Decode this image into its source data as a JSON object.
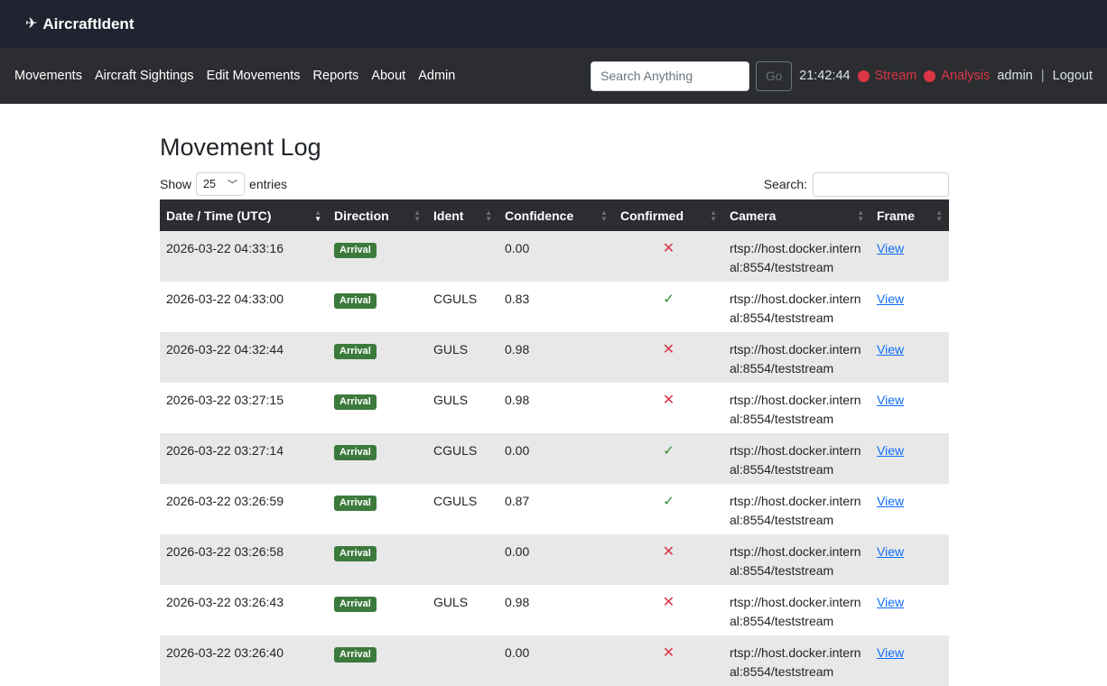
{
  "brand": {
    "icon": "airplane-icon",
    "name": "AircraftIdent"
  },
  "nav": {
    "items": [
      "Movements",
      "Aircraft Sightings",
      "Edit Movements",
      "Reports",
      "About",
      "Admin"
    ],
    "search_placeholder": "Search Anything",
    "go_label": "Go",
    "clock": "21:42:44",
    "stream_label": "Stream",
    "analysis_label": "Analysis",
    "user": "admin",
    "separator": "|",
    "logout_label": "Logout",
    "status_color": "#dc3545"
  },
  "page": {
    "title": "Movement Log",
    "show_label": "Show",
    "entries_value": "25",
    "entries_label": "entries",
    "search_label": "Search:"
  },
  "table": {
    "columns": [
      "Date / Time (UTC)",
      "Direction",
      "Ident",
      "Confidence",
      "Confirmed",
      "Camera",
      "Frame"
    ],
    "rows": [
      {
        "datetime": "2026-03-22 04:33:16",
        "direction": "Arrival",
        "ident": "",
        "confidence": "0.00",
        "confirmed": "✕",
        "camera": "rtsp://host.docker.internal:8554/teststream",
        "frame": "View"
      },
      {
        "datetime": "2026-03-22 04:33:00",
        "direction": "Arrival",
        "ident": "CGULS",
        "confidence": "0.83",
        "confirmed": "✓",
        "camera": "rtsp://host.docker.internal:8554/teststream",
        "frame": "View"
      },
      {
        "datetime": "2026-03-22 04:32:44",
        "direction": "Arrival",
        "ident": "GULS",
        "confidence": "0.98",
        "confirmed": "✕",
        "camera": "rtsp://host.docker.internal:8554/teststream",
        "frame": "View"
      },
      {
        "datetime": "2026-03-22 03:27:15",
        "direction": "Arrival",
        "ident": "GULS",
        "confidence": "0.98",
        "confirmed": "✕",
        "camera": "rtsp://host.docker.internal:8554/teststream",
        "frame": "View"
      },
      {
        "datetime": "2026-03-22 03:27:14",
        "direction": "Arrival",
        "ident": "CGULS",
        "confidence": "0.00",
        "confirmed": "✓",
        "camera": "rtsp://host.docker.internal:8554/teststream",
        "frame": "View"
      },
      {
        "datetime": "2026-03-22 03:26:59",
        "direction": "Arrival",
        "ident": "CGULS",
        "confidence": "0.87",
        "confirmed": "✓",
        "camera": "rtsp://host.docker.internal:8554/teststream",
        "frame": "View"
      },
      {
        "datetime": "2026-03-22 03:26:58",
        "direction": "Arrival",
        "ident": "",
        "confidence": "0.00",
        "confirmed": "✕",
        "camera": "rtsp://host.docker.internal:8554/teststream",
        "frame": "View"
      },
      {
        "datetime": "2026-03-22 03:26:43",
        "direction": "Arrival",
        "ident": "GULS",
        "confidence": "0.98",
        "confirmed": "✕",
        "camera": "rtsp://host.docker.internal:8554/teststream",
        "frame": "View"
      },
      {
        "datetime": "2026-03-22 03:26:40",
        "direction": "Arrival",
        "ident": "",
        "confidence": "0.00",
        "confirmed": "✕",
        "camera": "rtsp://host.docker.internal:8554/teststream",
        "frame": "View"
      }
    ]
  },
  "colors": {
    "topbar": "#202330",
    "navbar": "#2b2d31",
    "arrival_badge": "#3c7a3c",
    "confirmed_yes": "#2e8b2e",
    "confirmed_no": "#dc3545",
    "link": "#0d6efd"
  }
}
